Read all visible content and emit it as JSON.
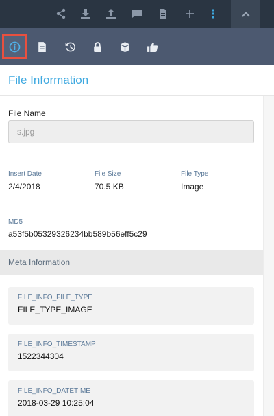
{
  "panel": {
    "title": "File Information"
  },
  "file": {
    "name_label": "File Name",
    "name_value": "s.jpg",
    "insert_date_label": "Insert Date",
    "insert_date_value": "2/4/2018",
    "file_size_label": "File Size",
    "file_size_value": "70.5 KB",
    "file_type_label": "File Type",
    "file_type_value": "Image",
    "md5_label": "MD5",
    "md5_value": "a53f5b05329326234bb589b56eff5c29"
  },
  "meta": {
    "header": "Meta Information",
    "items": [
      {
        "key": "FILE_INFO_FILE_TYPE",
        "value": "FILE_TYPE_IMAGE"
      },
      {
        "key": "FILE_INFO_TIMESTAMP",
        "value": "1522344304"
      },
      {
        "key": "FILE_INFO_DATETIME",
        "value": "2018-03-29 10:25:04"
      }
    ]
  },
  "icons": {
    "toolbar": [
      "share-icon",
      "download-icon",
      "upload-icon",
      "comment-icon",
      "document-icon",
      "plus-icon",
      "more-vertical-icon",
      "chevron-up-icon"
    ],
    "tabs": [
      "info-icon",
      "details-icon",
      "history-icon",
      "lock-icon",
      "packages-icon",
      "thumbs-up-icon"
    ]
  },
  "colors": {
    "accent": "#3fa9e0",
    "active_tab_outline": "#e9503f",
    "toolbar_bg": "#2a3542",
    "tabbar_bg": "#4c5970"
  }
}
